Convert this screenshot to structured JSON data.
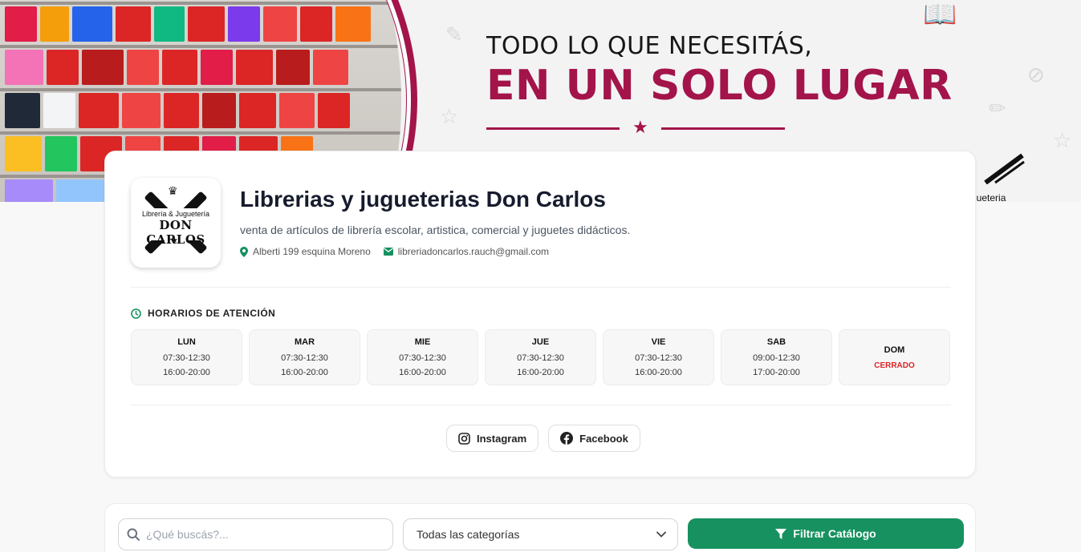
{
  "banner": {
    "headline_top": "TODO LO QUE NECESITÁS,",
    "headline_main": "EN UN SOLO LUGAR",
    "brand_partial": "gueteria",
    "colors": {
      "accent": "#a3144a",
      "text": "#161616"
    }
  },
  "store": {
    "name": "Librerias y jugueterias Don Carlos",
    "description": "venta de artículos de librería escolar, artistica, comercial y juguetes didácticos.",
    "address": "Alberti 199 esquina Moreno",
    "email": "libreriadoncarlos.rauch@gmail.com",
    "logo": {
      "top_text": "Librería & Juguetería",
      "main_text": "DON CARLOS"
    }
  },
  "hours": {
    "title": "HORARIOS DE ATENCIÓN",
    "days": [
      {
        "name": "LUN",
        "slot1": "07:30-12:30",
        "slot2": "16:00-20:00"
      },
      {
        "name": "MAR",
        "slot1": "07:30-12:30",
        "slot2": "16:00-20:00"
      },
      {
        "name": "MIE",
        "slot1": "07:30-12:30",
        "slot2": "16:00-20:00"
      },
      {
        "name": "JUE",
        "slot1": "07:30-12:30",
        "slot2": "16:00-20:00"
      },
      {
        "name": "VIE",
        "slot1": "07:30-12:30",
        "slot2": "16:00-20:00"
      },
      {
        "name": "SAB",
        "slot1": "09:00-12:30",
        "slot2": "17:00-20:00"
      },
      {
        "name": "DOM",
        "status": "CERRADO"
      }
    ]
  },
  "socials": {
    "instagram": "Instagram",
    "facebook": "Facebook"
  },
  "filters": {
    "search_placeholder": "¿Qué buscás?...",
    "category_selected": "Todas las categorías",
    "filter_button": "Filtrar Catálogo",
    "accent": "#16915f"
  }
}
